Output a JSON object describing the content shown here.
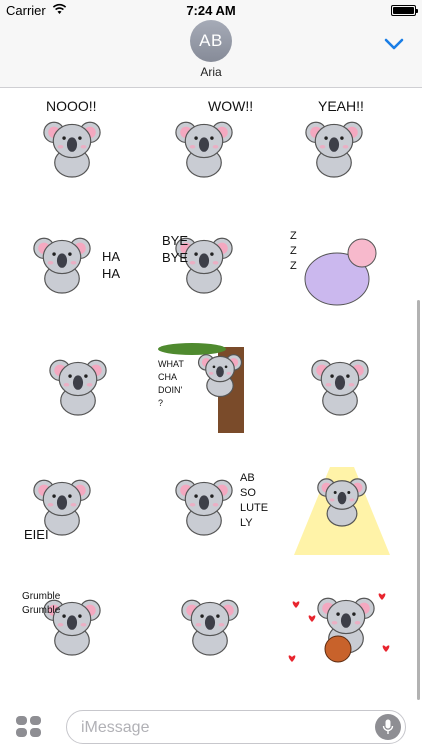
{
  "status_bar": {
    "carrier": "Carrier",
    "time": "7:24 AM",
    "battery_level": 1.0
  },
  "header": {
    "avatar_initials": "AB",
    "contact_name": "Aria",
    "collapse_icon": "chevron-down-icon"
  },
  "stickers": [
    {
      "caption": "NOOO!!",
      "name": "koala-nooo"
    },
    {
      "caption": "WOW!!",
      "name": "koala-wow"
    },
    {
      "caption": "YEAH!!",
      "name": "koala-yeah"
    },
    {
      "caption": "HA HA",
      "name": "koala-haha"
    },
    {
      "caption": "BYE BYE",
      "name": "koala-bye-bye"
    },
    {
      "caption": "Z Z Z",
      "name": "koala-sleeping"
    },
    {
      "caption": "",
      "name": "koala-shy"
    },
    {
      "caption": "WHAT CHA DOIN' ?",
      "name": "koala-what-cha-doin"
    },
    {
      "caption": "",
      "name": "koala-jumping"
    },
    {
      "caption": "EIEI",
      "name": "koala-eiei"
    },
    {
      "caption": "AB SO LUTE LY",
      "name": "koala-absolutely"
    },
    {
      "caption": "",
      "name": "koala-singing"
    },
    {
      "caption": "Grumble Grumble",
      "name": "koala-grumble"
    },
    {
      "caption": "",
      "name": "koala-whistling"
    },
    {
      "caption": "",
      "name": "koala-love-basketball"
    }
  ],
  "compose": {
    "placeholder": "iMessage",
    "apps_icon": "app-grid-icon",
    "mic_icon": "microphone-icon"
  },
  "colors": {
    "accent": "#1a7ee6",
    "koala_fur": "#c9ccd3",
    "koala_ear": "#f4a8c0",
    "koala_nose": "#3d3f48"
  }
}
